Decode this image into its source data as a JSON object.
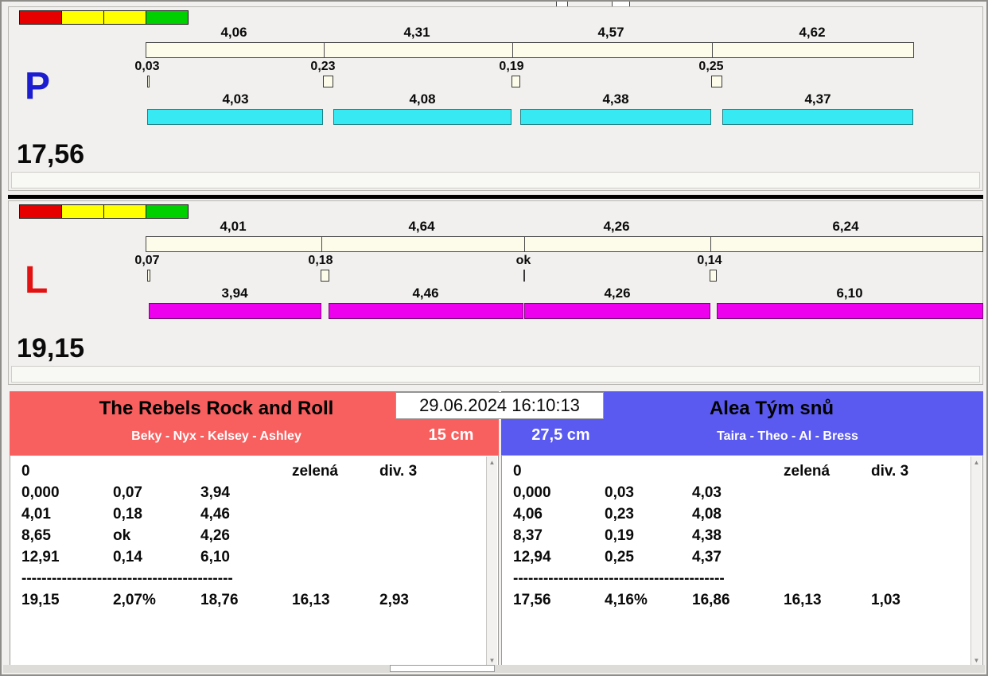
{
  "window": {
    "timestamp": "29.06.2024 16:10:13",
    "icons": {
      "scroll_up": "▲",
      "scroll_down": "▼"
    },
    "colors": {
      "right_lane_bar": "#36e9f2",
      "left_lane_bar": "#ee00ee",
      "left_team_header": "#f85f5f",
      "right_team_header": "#5a5af0",
      "lane_letter_p": "#1c1cd0",
      "lane_letter_l": "#e31212",
      "status_lights": [
        "#e60000",
        "#ffff00",
        "#ffff00",
        "#00cf00"
      ]
    }
  },
  "lanes": [
    {
      "letter": "P",
      "total": "17,56",
      "splits": [
        "4,06",
        "4,31",
        "4,57",
        "4,62"
      ],
      "crossovers": [
        "0,03",
        "0,23",
        "0,19",
        "0,25"
      ],
      "runs": [
        "4,03",
        "4,08",
        "4,38",
        "4,37"
      ]
    },
    {
      "letter": "L",
      "total": "19,15",
      "splits": [
        "4,01",
        "4,64",
        "4,26",
        "6,24"
      ],
      "crossovers": [
        "0,07",
        "0,18",
        "ok",
        "0,14"
      ],
      "runs": [
        "3,94",
        "4,46",
        "4,26",
        "6,10"
      ]
    }
  ],
  "teams": [
    {
      "name": "The Rebels Rock and Roll",
      "members": "Beky - Nyx - Kelsey - Ashley",
      "jump_height": "15 cm",
      "status": {
        "start": "0",
        "light": "zelená",
        "division": "div. 3"
      },
      "rows": [
        [
          "0,000",
          "0,07",
          "3,94"
        ],
        [
          "4,01",
          "0,18",
          "4,46"
        ],
        [
          "8,65",
          "ok",
          "4,26"
        ],
        [
          "12,91",
          "0,14",
          "6,10"
        ]
      ],
      "separator": "------------------------------------------",
      "summary": [
        "19,15",
        "2,07%",
        "18,76",
        "16,13",
        "2,93"
      ]
    },
    {
      "name": "Alea Tým snů",
      "members": "Taira - Theo - Al - Bress",
      "jump_height": "27,5 cm",
      "status": {
        "start": "0",
        "light": "zelená",
        "division": "div. 3"
      },
      "rows": [
        [
          "0,000",
          "0,03",
          "4,03"
        ],
        [
          "4,06",
          "0,23",
          "4,08"
        ],
        [
          "8,37",
          "0,19",
          "4,38"
        ],
        [
          "12,94",
          "0,25",
          "4,37"
        ]
      ],
      "separator": "------------------------------------------",
      "summary": [
        "17,56",
        "4,16%",
        "16,86",
        "16,13",
        "1,03"
      ]
    }
  ]
}
